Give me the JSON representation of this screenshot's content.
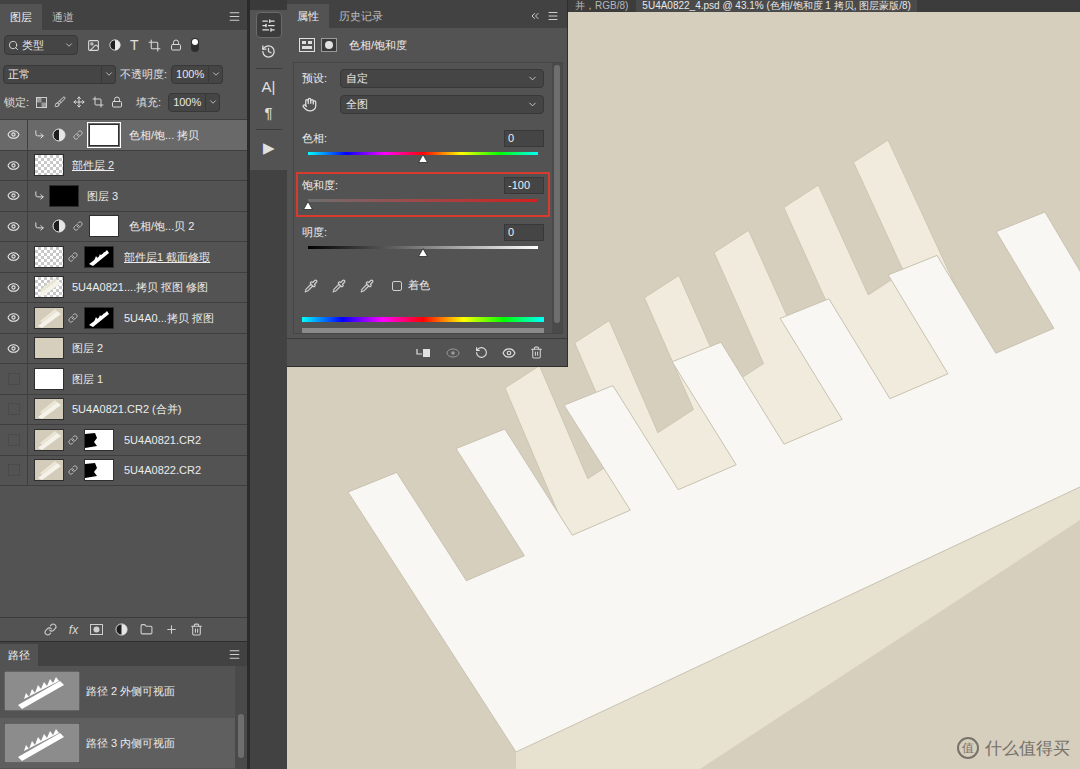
{
  "layers_panel": {
    "tabs": [
      {
        "label": "图层",
        "selected": true
      },
      {
        "label": "通道",
        "selected": false
      }
    ],
    "filter": {
      "label": "类型",
      "type_glyph": "T"
    },
    "blend_mode": "正常",
    "opacity": {
      "label": "不透明度:",
      "value": "100%"
    },
    "lock": {
      "label": "锁定:"
    },
    "fill": {
      "label": "填充:",
      "value": "100%"
    },
    "layers": [
      {
        "name": "色相/饱... 拷贝",
        "visible": true,
        "selected": true,
        "clipped": true,
        "kind": "adjustment",
        "mask": "white",
        "mask_selected": true,
        "underlined": false
      },
      {
        "name": "部件层 2",
        "visible": true,
        "selected": false,
        "clipped": false,
        "kind": "pixel",
        "thumb": "checker",
        "mask": "none",
        "underlined": true
      },
      {
        "name": "图层 3",
        "visible": true,
        "selected": false,
        "clipped": true,
        "kind": "pixel",
        "thumb": "black",
        "mask": "none",
        "underlined": false
      },
      {
        "name": "色相/饱...贝 2",
        "visible": true,
        "selected": false,
        "clipped": true,
        "kind": "adjustment",
        "mask": "white",
        "mask_selected": false,
        "underlined": false
      },
      {
        "name": "部件层1 截面修瑕",
        "visible": true,
        "selected": false,
        "clipped": false,
        "kind": "pixel",
        "thumb": "checker",
        "mask": "comb",
        "mask_selected": false,
        "underlined": true
      },
      {
        "name": "5U4A0821....拷贝 抠图 修图",
        "visible": true,
        "selected": false,
        "clipped": false,
        "kind": "pixel",
        "thumb": "photo-checker",
        "mask": "none",
        "underlined": false
      },
      {
        "name": "5U4A0...拷贝 抠图",
        "visible": true,
        "selected": false,
        "clipped": false,
        "kind": "pixel",
        "thumb": "photo",
        "mask": "comb",
        "mask_selected": false,
        "underlined": false
      },
      {
        "name": "图层 2",
        "visible": true,
        "selected": false,
        "clipped": false,
        "kind": "pixel",
        "thumb": "beige",
        "mask": "none",
        "underlined": false
      },
      {
        "name": "图层 1",
        "visible": false,
        "selected": false,
        "clipped": false,
        "kind": "pixel",
        "thumb": "white",
        "mask": "none",
        "underlined": false
      },
      {
        "name": "5U4A0821.CR2 (合并)",
        "visible": false,
        "selected": false,
        "clipped": false,
        "kind": "pixel",
        "thumb": "photo",
        "mask": "none",
        "underlined": false
      },
      {
        "name": "5U4A0821.CR2",
        "visible": false,
        "selected": false,
        "clipped": false,
        "kind": "pixel",
        "thumb": "photo",
        "mask": "blob",
        "mask_selected": false,
        "underlined": false
      },
      {
        "name": "5U4A0822.CR2",
        "visible": false,
        "selected": false,
        "clipped": false,
        "kind": "pixel",
        "thumb": "photo",
        "mask": "blob",
        "mask_selected": false,
        "underlined": false
      }
    ],
    "footer": {
      "fx": "fx"
    }
  },
  "paths_panel": {
    "title": "路径",
    "paths": [
      {
        "name": "路径 2 外侧可视面",
        "selected": false
      },
      {
        "name": "路径 3 内侧可视面",
        "selected": true
      }
    ]
  },
  "toolbar": {
    "items": [
      {
        "kind": "adjustments",
        "selected": true
      },
      {
        "kind": "history",
        "selected": false
      },
      {
        "kind": "glyph",
        "text": "A|",
        "selected": false
      },
      {
        "kind": "glyph",
        "text": "¶",
        "selected": false
      },
      {
        "kind": "glyph",
        "text": "▶",
        "selected": false
      }
    ]
  },
  "properties": {
    "tabs": [
      {
        "label": "属性",
        "selected": true
      },
      {
        "label": "历史记录",
        "selected": false
      }
    ],
    "title": "色相/饱和度",
    "preset": {
      "label": "预设:",
      "value": "自定"
    },
    "channel": "全图",
    "sliders": [
      {
        "label": "色相:",
        "value": "0",
        "level": 0.5,
        "kind": "hue",
        "highlighted": false
      },
      {
        "label": "饱和度:",
        "value": "-100",
        "level": 0,
        "kind": "saturation",
        "highlighted": true
      },
      {
        "label": "明度:",
        "value": "0",
        "level": 0.5,
        "kind": "lightness",
        "highlighted": false
      }
    ],
    "colorize": {
      "label": "着色",
      "checked": false
    }
  },
  "document": {
    "tabs": [
      {
        "label": "并，RGB/8)",
        "selected": false
      },
      {
        "label": "5U4A0822_4.psd @ 43.1% (色相/饱和度 1 拷贝, 图层蒙版/8)",
        "selected": true
      }
    ],
    "watermark": {
      "logo": "值",
      "text": "什么值得买"
    }
  }
}
